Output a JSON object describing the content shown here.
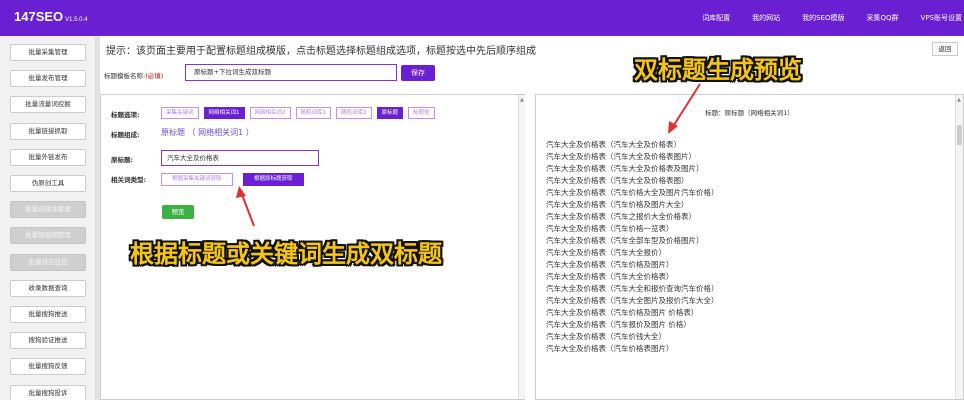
{
  "header": {
    "brand": "147SEO",
    "version": "V1.5.0.4",
    "nav": [
      "词库配置",
      "我的网站",
      "我的SEO模版",
      "采集QQ群",
      "VPS账号设置"
    ]
  },
  "sidebar": {
    "items": [
      {
        "label": "批量采集管理",
        "disabled": false
      },
      {
        "label": "批量发布管理",
        "disabled": false
      },
      {
        "label": "批量流量词挖掘",
        "disabled": false
      },
      {
        "label": "批量链接抓取",
        "disabled": false
      },
      {
        "label": "批量外链发布",
        "disabled": false
      },
      {
        "label": "伪原创工具",
        "disabled": false
      },
      {
        "label": "批量自媒体管理",
        "disabled": true
      },
      {
        "label": "批量短视频管理",
        "disabled": true
      },
      {
        "label": "批量排名监控",
        "disabled": true
      },
      {
        "label": "收录数据查询",
        "disabled": false
      },
      {
        "label": "批量搜狗推送",
        "disabled": false
      },
      {
        "label": "搜狗验证推送",
        "disabled": false
      },
      {
        "label": "批量搜狗反馈",
        "disabled": false
      },
      {
        "label": "批量搜狗投诉",
        "disabled": false
      }
    ]
  },
  "main": {
    "tip": "提示：该页面主要用于配置标题组成模版，点击标题选择标题组成选项，标题按选中先后顺序组成",
    "back_label": "返回",
    "template_label": "标题模板名称:",
    "required_mark": "(必填)",
    "template_value": "原标题+下拉词生成双标题",
    "save_label": "保存",
    "title_options_label": "标题选项:",
    "title_options": [
      {
        "label": "采集关键词",
        "selected": false
      },
      {
        "label": "网络相关词1",
        "selected": true
      },
      {
        "label": "网络相关词2",
        "selected": false
      },
      {
        "label": "随机词库1",
        "selected": false
      },
      {
        "label": "随机词库2",
        "selected": false
      },
      {
        "label": "原标题",
        "selected": true
      },
      {
        "label": "标题党",
        "selected": false
      }
    ],
    "composition_label": "标题组成:",
    "composition_value": "原标题 （ 网络相关词1 ）",
    "original_title_label": "原标题:",
    "original_title_value": "汽车大全及价格表",
    "related_type_label": "相关词类型:",
    "related_types": [
      {
        "label": "根据采集关键词获取",
        "selected": false
      },
      {
        "label": "根据原标题获取",
        "selected": true
      }
    ],
    "preview_label": "预览"
  },
  "preview": {
    "header": "标题：原标题（网络相关词1）",
    "results": [
      "汽车大全及价格表（汽车大全及价格表）",
      "汽车大全及价格表（汽车大全及价格表图片）",
      "汽车大全及价格表（汽车大全及价格表及图片）",
      "汽车大全及价格表（汽车大全及价格表图）",
      "汽车大全及价格表（汽车价格大全及图片汽车价格）",
      "汽车大全及价格表（汽车价格及图片大全）",
      "汽车大全及价格表（汽车之报价大全价格表）",
      "汽车大全及价格表（汽车价格一览表）",
      "汽车大全及价格表（汽车全部车型及价格图片）",
      "汽车大全及价格表（汽车大全报价）",
      "汽车大全及价格表（汽车价格及图片）",
      "汽车大全及价格表（汽车大全价格表）",
      "汽车大全及价格表（汽车大全和报价查询汽车价格）",
      "汽车大全及价格表（汽车大全图片及报价汽车大全）",
      "汽车大全及价格表（汽车价格及图片 价格表）",
      "汽车大全及价格表（汽车报价及图片 价格）",
      "汽车大全及价格表（汽车价钱大全）",
      "汽车大全及价格表（汽车价格表图片）"
    ]
  },
  "annotations": {
    "top": "双标题生成预览",
    "middle": "根据标题或关键词生成双标题"
  },
  "colors": {
    "brand": "#6a1fd2",
    "annotation": "#f5c518",
    "arrow": "#e03030",
    "preview_button": "#3cb043"
  }
}
